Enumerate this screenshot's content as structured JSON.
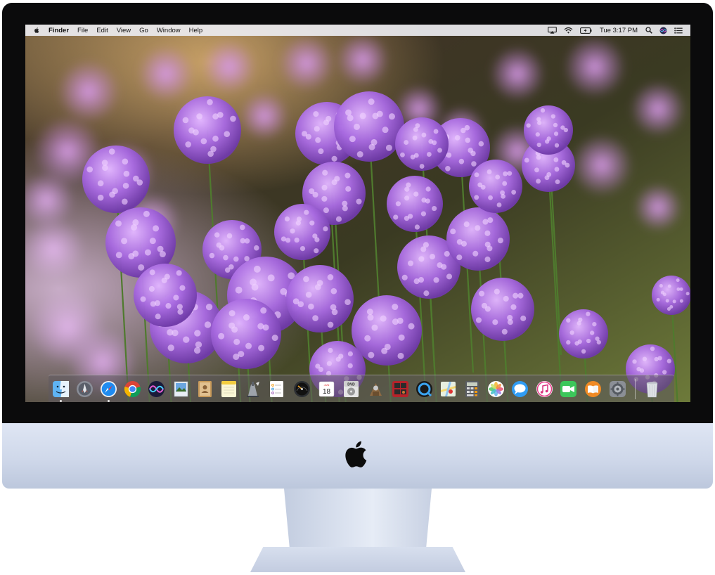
{
  "menubar": {
    "app_name": "Finder",
    "menus": [
      "File",
      "Edit",
      "View",
      "Go",
      "Window",
      "Help"
    ],
    "clock": "Tue 3:17 PM",
    "status_icons": [
      "airplay-icon",
      "wifi-icon",
      "battery-charging-icon",
      "search-icon",
      "siri-icon",
      "notification-center-icon"
    ]
  },
  "dock": {
    "apps": [
      {
        "name": "Finder",
        "icon": "finder-icon"
      },
      {
        "name": "Launchpad",
        "icon": "launchpad-icon"
      },
      {
        "name": "Safari",
        "icon": "safari-icon"
      },
      {
        "name": "Google Chrome",
        "icon": "chrome-icon"
      },
      {
        "name": "Siri",
        "icon": "siri-icon"
      },
      {
        "name": "Preview",
        "icon": "preview-icon"
      },
      {
        "name": "Contacts",
        "icon": "contacts-icon"
      },
      {
        "name": "Notes",
        "icon": "notes-icon"
      },
      {
        "name": "Script Editor",
        "icon": "script-editor-icon"
      },
      {
        "name": "Reminders",
        "icon": "reminders-icon"
      },
      {
        "name": "Dashboard",
        "icon": "dashboard-icon"
      },
      {
        "name": "Calendar",
        "icon": "calendar-icon"
      },
      {
        "name": "DVD Player",
        "icon": "dvd-player-icon"
      },
      {
        "name": "Automator",
        "icon": "automator-icon"
      },
      {
        "name": "Photo Booth",
        "icon": "photo-booth-icon"
      },
      {
        "name": "QuickTime Player",
        "icon": "quicktime-icon"
      },
      {
        "name": "Maps",
        "icon": "maps-icon"
      },
      {
        "name": "Calculator",
        "icon": "calculator-icon"
      },
      {
        "name": "Photos",
        "icon": "photos-icon"
      },
      {
        "name": "Messages",
        "icon": "messages-icon"
      },
      {
        "name": "iTunes",
        "icon": "itunes-icon"
      },
      {
        "name": "FaceTime",
        "icon": "facetime-icon"
      },
      {
        "name": "iBooks",
        "icon": "ibooks-icon"
      },
      {
        "name": "System Preferences",
        "icon": "system-preferences-icon"
      },
      {
        "name": "Trash",
        "icon": "trash-icon"
      }
    ],
    "calendar": {
      "month": "JUN",
      "day": "18"
    },
    "dvd_label": "DVD"
  },
  "colors": {
    "menubar_bg": "#ecedf0",
    "flower": "#9a5fd8",
    "flower_highlight": "#d9a8f5",
    "stem": "#4f7a2e",
    "chin": "#d3dbec"
  }
}
